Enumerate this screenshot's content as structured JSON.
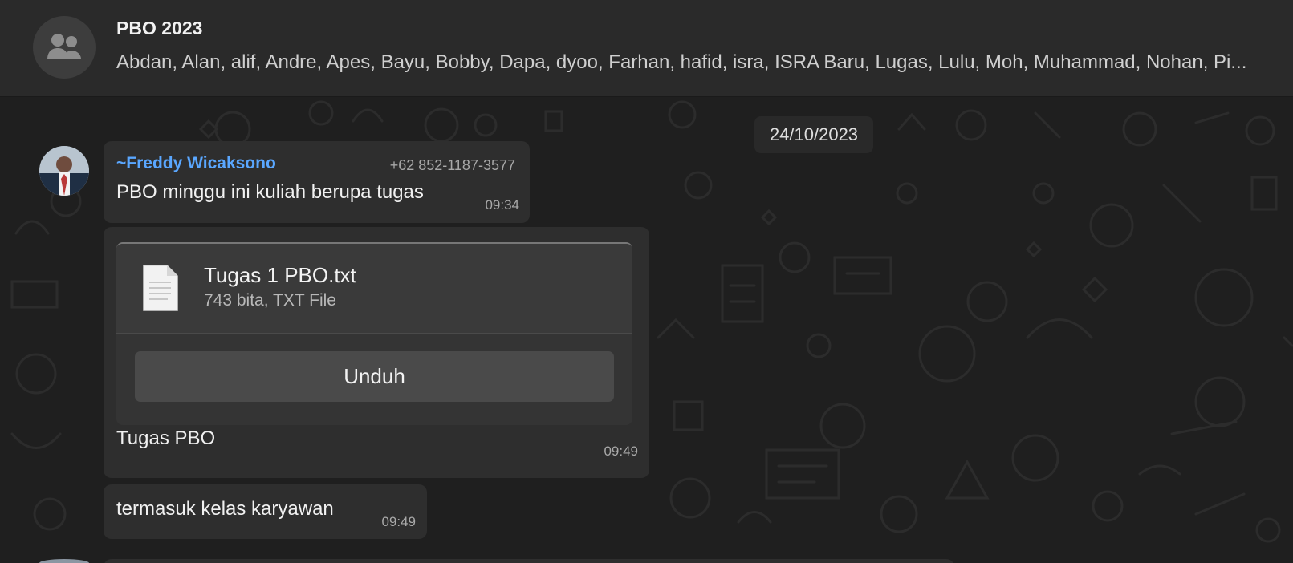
{
  "header": {
    "group_name": "PBO 2023",
    "members": "Abdan, Alan, alif, Andre, Apes, Bayu, Bobby, Dapa, dyoo, Farhan, hafid, isra, ISRA Baru, Lugas, Lulu, Moh, Muhammad, Nohan, Pi...",
    "avatar_icon": "group-people-icon"
  },
  "chat": {
    "date_label": "24/10/2023",
    "sender_name": "~Freddy Wicaksono",
    "sender_phone": "+62 852-1187-3577",
    "messages": [
      {
        "text": "PBO minggu ini kuliah berupa tugas",
        "time": "09:34"
      },
      {
        "file": {
          "name": "Tugas 1 PBO.txt",
          "meta": "743 bita, TXT File",
          "button_label": "Unduh",
          "icon": "document-icon"
        },
        "caption": "Tugas PBO",
        "time": "09:49"
      },
      {
        "text": "termasuk kelas karyawan",
        "time": "09:49"
      }
    ]
  },
  "colors": {
    "header_bg": "#2a2a2a",
    "chat_bg": "#1f1f1f",
    "bubble_bg": "#2e2e2e",
    "sender_color": "#5aa7ff"
  }
}
